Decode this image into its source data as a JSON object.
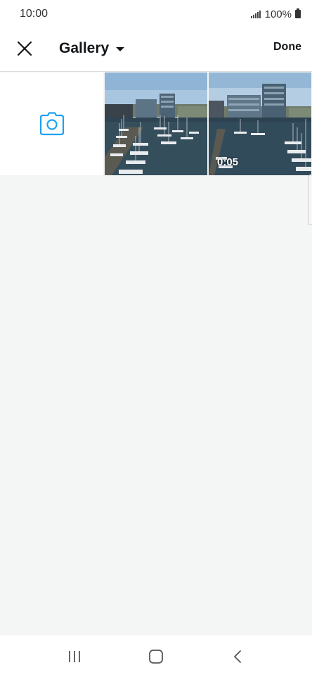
{
  "status_bar": {
    "time": "10:00",
    "battery": "100%"
  },
  "header": {
    "title": "Gallery",
    "done_label": "Done",
    "close_icon": "close-icon",
    "dropdown_icon": "caret-down-icon"
  },
  "grid": {
    "camera_icon": "camera-icon",
    "items": [
      {
        "type": "photo",
        "duration": ""
      },
      {
        "type": "video",
        "duration": "0:05"
      }
    ]
  },
  "colors": {
    "accent": "#1da1f2",
    "text": "#14171a",
    "background": "#f4f6f5"
  },
  "nav_bar": {
    "icons": [
      "recent-apps-icon",
      "home-icon",
      "back-icon"
    ]
  }
}
